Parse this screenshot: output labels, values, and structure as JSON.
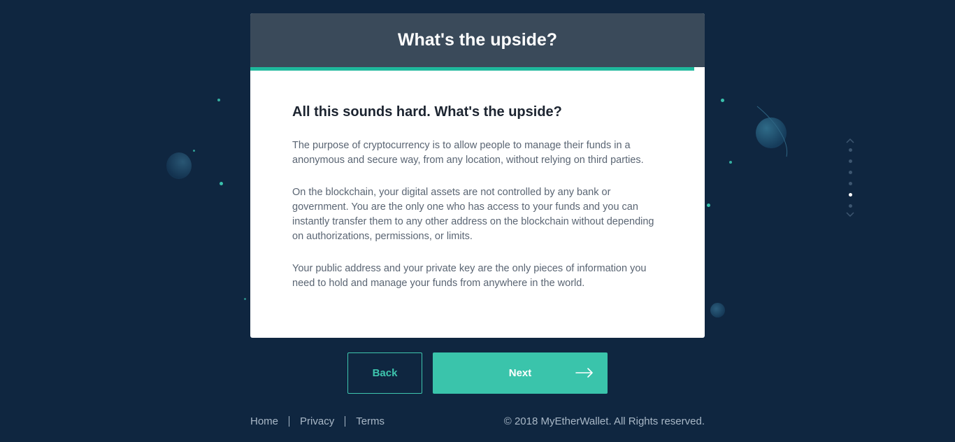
{
  "header": {
    "title": "What's the upside?"
  },
  "progress": {
    "value": 0.977
  },
  "content": {
    "heading": "All this sounds hard. What's the upside?",
    "paragraphs": [
      "The purpose of cryptocurrency is to allow people to manage their funds in a anonymous and secure way, from any location, without relying on third parties.",
      "On the blockchain, your digital assets are not controlled by any bank or government. You are the only one who has access to your funds and you can instantly transfer them to any other address on the blockchain without depending on authorizations, permissions, or limits.",
      "Your public address and your private key are the only pieces of information you need to hold and manage your funds from anywhere in the world."
    ]
  },
  "pager": {
    "total": 6,
    "active_index": 4,
    "up_icon": "chevron-up-icon",
    "down_icon": "chevron-down-icon"
  },
  "buttons": {
    "back_label": "Back",
    "next_label": "Next",
    "next_icon": "arrow-right-icon"
  },
  "footer": {
    "links": [
      "Home",
      "Privacy",
      "Terms"
    ],
    "copyright": "© 2018 MyEtherWallet. All Rights reserved."
  },
  "colors": {
    "background": "#0f2640",
    "header": "#3a4a5a",
    "accent": "#3ac4ab",
    "progress": "#1fb99d"
  }
}
